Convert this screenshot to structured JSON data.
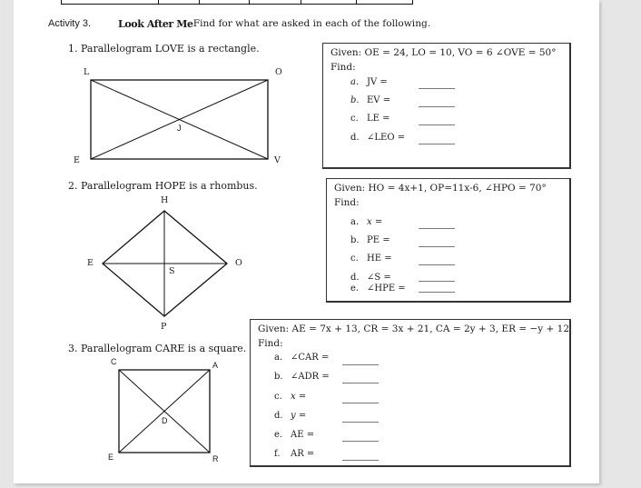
{
  "activity": {
    "number": "Activity 3.",
    "title": "Look After Me",
    "instruction": ". Find for what are asked in each of the following."
  },
  "problems": [
    {
      "label": "1.  Parallelogram LOVE is a rectangle.",
      "shape": "rectangle",
      "vertices": {
        "top_left": "L",
        "top_right": "O",
        "bottom_left": "E",
        "bottom_right": "V",
        "center": "J"
      },
      "given": "Given: OE = 24, LO = 10, VO = 6  ∠OVE = 50°",
      "find_label": "Find:",
      "items": [
        {
          "letter": "a.",
          "expr": "JV ="
        },
        {
          "letter": "b.",
          "expr": "EV ="
        },
        {
          "letter": "c.",
          "expr": "LE ="
        },
        {
          "letter": "d.",
          "expr": "∠LEO ="
        }
      ]
    },
    {
      "label": "2.  Parallelogram HOPE is a rhombus.",
      "shape": "rhombus",
      "vertices": {
        "top": "H",
        "right": "O",
        "bottom": "P",
        "left": "E",
        "center": "S"
      },
      "given": "Given: HO = 4x+1, OP=11x-6, ∠HPO = 70°",
      "find_label": "Find:",
      "items": [
        {
          "letter": "a.",
          "expr": "x ="
        },
        {
          "letter": "b.",
          "expr": "PE ="
        },
        {
          "letter": "c.",
          "expr": "HE ="
        },
        {
          "letter": "d.",
          "expr": "∠S ="
        },
        {
          "letter": "e.",
          "expr": "∠HPE ="
        }
      ]
    },
    {
      "label": "3.  Parallelogram CARE is a square.",
      "shape": "square",
      "vertices": {
        "top_left": "C",
        "top_right": "A",
        "bottom_left": "E",
        "bottom_right": "R",
        "center": "D"
      },
      "given": "Given:  AE = 7x + 13, CR = 3x + 21, CA = 2y + 3, ER = −y + 12",
      "find_label": "Find:",
      "items": [
        {
          "letter": "a.",
          "expr": "∠CAR ="
        },
        {
          "letter": "b.",
          "expr": "∠ADR ="
        },
        {
          "letter": "c.",
          "expr": "x ="
        },
        {
          "letter": "d.",
          "expr": "y ="
        },
        {
          "letter": "e.",
          "expr": "AE ="
        },
        {
          "letter": "f.",
          "expr": "AR ="
        }
      ]
    }
  ]
}
